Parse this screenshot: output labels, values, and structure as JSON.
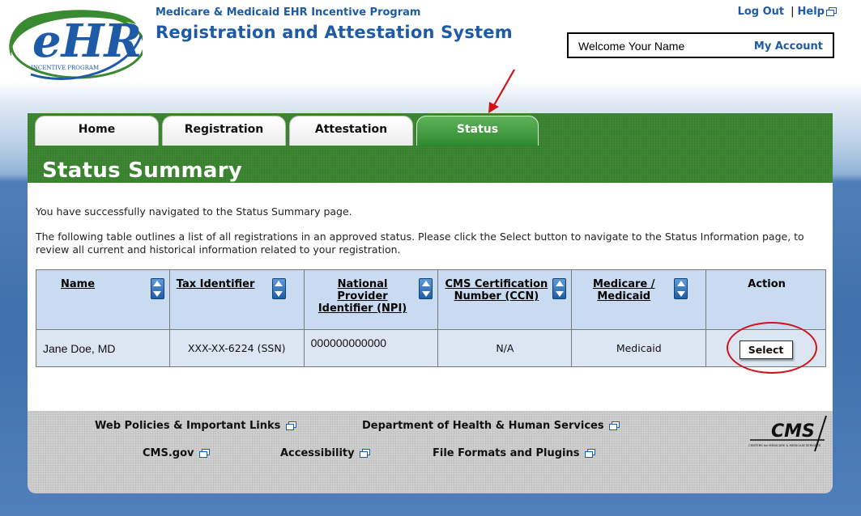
{
  "header": {
    "logo": {
      "letters": "eHR",
      "tagline": "INCENTIVE PROGRAM"
    },
    "program_subtitle": "Medicare & Medicaid EHR Incentive Program",
    "program_title": "Registration and Attestation System",
    "logout_label": "Log Out",
    "help_label": "Help",
    "welcome_text": "Welcome Your Name",
    "my_account_label": "My Account"
  },
  "tabs": [
    {
      "label": "Home",
      "active": false
    },
    {
      "label": "Registration",
      "active": false
    },
    {
      "label": "Attestation",
      "active": false
    },
    {
      "label": "Status",
      "active": true
    }
  ],
  "page": {
    "heading": "Status Summary",
    "intro_line1": "You have successfully navigated to the Status Summary page.",
    "intro_line2": "The following table outlines a list of all registrations in an approved status. Please click the Select button to navigate to the Status Information page, to review all current and historical information related to your registration."
  },
  "table": {
    "columns": [
      {
        "label": "Name",
        "sortable": true
      },
      {
        "label": "Tax Identifier",
        "sortable": true
      },
      {
        "label": "National Provider Identifier (NPI)",
        "sortable": true
      },
      {
        "label": "CMS Certification Number (CCN)",
        "sortable": true
      },
      {
        "label": "Medicare / Medicaid",
        "sortable": true
      },
      {
        "label": "Action",
        "sortable": false
      }
    ],
    "rows": [
      {
        "name": "Jane Doe, MD",
        "tax_identifier": "XXX-XX-6224 (SSN)",
        "npi": "000000000000",
        "ccn": "N/A",
        "program": "Medicaid",
        "action_label": "Select"
      }
    ]
  },
  "footer": {
    "links": {
      "web_policies": "Web Policies & Important Links",
      "hhs": "Department of Health & Human Services",
      "cms_gov": "CMS.gov",
      "accessibility": "Accessibility",
      "file_formats": "File Formats and Plugins"
    },
    "cms_logo": {
      "letters": "CMS",
      "tagline": "CENTERS for MEDICARE & MEDICAID SERVICES"
    }
  },
  "colors": {
    "brand_blue": "#1f5aa6",
    "nav_green": "#3f8c34",
    "annotation_red": "#d0121b"
  }
}
